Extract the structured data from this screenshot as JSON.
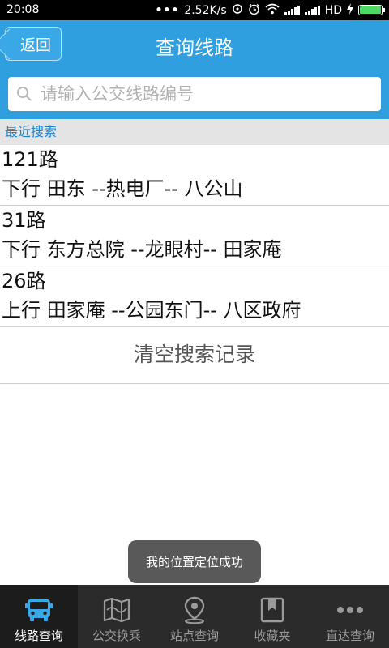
{
  "status_bar": {
    "time": "20:08",
    "dots": "•••",
    "speed": "2.52K/s",
    "network": "HD",
    "battery_color": "#4cd964"
  },
  "header": {
    "back_label": "返回",
    "title": "查询线路",
    "accent_color": "#2f9fe0"
  },
  "search": {
    "placeholder": "请输入公交线路编号",
    "value": ""
  },
  "recent": {
    "label": "最近搜索",
    "items": [
      {
        "name": "121路",
        "desc": "下行 田东 --热电厂-- 八公山"
      },
      {
        "name": "31路",
        "desc": "下行 东方总院 --龙眼村-- 田家庵"
      },
      {
        "name": "26路",
        "desc": "上行 田家庵 --公园东门-- 八区政府"
      }
    ],
    "clear_label": "清空搜索记录"
  },
  "toast": {
    "text": "我的位置定位成功"
  },
  "bottom_nav": {
    "items": [
      {
        "label": "线路查询",
        "icon": "bus-icon",
        "active": true
      },
      {
        "label": "公交换乘",
        "icon": "map-icon",
        "active": false
      },
      {
        "label": "站点查询",
        "icon": "location-pin-icon",
        "active": false
      },
      {
        "label": "收藏夹",
        "icon": "bookmark-icon",
        "active": false
      },
      {
        "label": "直达查询",
        "icon": "more-icon",
        "active": false
      }
    ]
  }
}
